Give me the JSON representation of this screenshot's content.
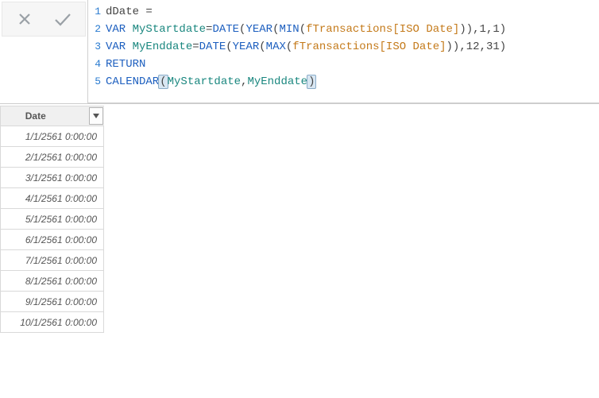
{
  "formula": {
    "lines": [
      {
        "n": "1",
        "tokens": [
          {
            "cls": "tok-plain",
            "t": "dDate ="
          }
        ]
      },
      {
        "n": "2",
        "tokens": [
          {
            "cls": "tok-kw",
            "t": "VAR "
          },
          {
            "cls": "tok-var",
            "t": "MyStartdate"
          },
          {
            "cls": "tok-plain",
            "t": "="
          },
          {
            "cls": "tok-func",
            "t": "DATE"
          },
          {
            "cls": "tok-plain",
            "t": "("
          },
          {
            "cls": "tok-func",
            "t": "YEAR"
          },
          {
            "cls": "tok-plain",
            "t": "("
          },
          {
            "cls": "tok-func",
            "t": "MIN"
          },
          {
            "cls": "tok-plain",
            "t": "("
          },
          {
            "cls": "tok-table",
            "t": "fTransactions"
          },
          {
            "cls": "tok-col",
            "t": "[ISO Date]"
          },
          {
            "cls": "tok-plain",
            "t": ")),"
          },
          {
            "cls": "tok-num",
            "t": "1"
          },
          {
            "cls": "tok-plain",
            "t": ","
          },
          {
            "cls": "tok-num",
            "t": "1"
          },
          {
            "cls": "tok-plain",
            "t": ")"
          }
        ]
      },
      {
        "n": "3",
        "tokens": [
          {
            "cls": "tok-kw",
            "t": "VAR "
          },
          {
            "cls": "tok-var",
            "t": "MyEnddate"
          },
          {
            "cls": "tok-plain",
            "t": "="
          },
          {
            "cls": "tok-func",
            "t": "DATE"
          },
          {
            "cls": "tok-plain",
            "t": "("
          },
          {
            "cls": "tok-func",
            "t": "YEAR"
          },
          {
            "cls": "tok-plain",
            "t": "("
          },
          {
            "cls": "tok-func",
            "t": "MAX"
          },
          {
            "cls": "tok-plain",
            "t": "("
          },
          {
            "cls": "tok-table",
            "t": "fTransactions"
          },
          {
            "cls": "tok-col",
            "t": "[ISO Date]"
          },
          {
            "cls": "tok-plain",
            "t": ")),"
          },
          {
            "cls": "tok-num",
            "t": "12"
          },
          {
            "cls": "tok-plain",
            "t": ","
          },
          {
            "cls": "tok-num",
            "t": "31"
          },
          {
            "cls": "tok-plain",
            "t": ")"
          }
        ]
      },
      {
        "n": "4",
        "tokens": [
          {
            "cls": "tok-kw",
            "t": "RETURN"
          }
        ]
      },
      {
        "n": "5",
        "tokens": [
          {
            "cls": "tok-func",
            "t": "CALENDAR"
          },
          {
            "cls": "tok-plain paren-hl",
            "t": "("
          },
          {
            "cls": "tok-var",
            "t": "MyStartdate"
          },
          {
            "cls": "tok-plain",
            "t": ","
          },
          {
            "cls": "tok-var",
            "t": "MyEnddate"
          },
          {
            "cls": "tok-plain paren-hl",
            "t": ")"
          }
        ]
      }
    ]
  },
  "grid": {
    "column_header": "Date",
    "rows": [
      "1/1/2561 0:00:00",
      "2/1/2561 0:00:00",
      "3/1/2561 0:00:00",
      "4/1/2561 0:00:00",
      "5/1/2561 0:00:00",
      "6/1/2561 0:00:00",
      "7/1/2561 0:00:00",
      "8/1/2561 0:00:00",
      "9/1/2561 0:00:00",
      "10/1/2561 0:00:00"
    ]
  }
}
